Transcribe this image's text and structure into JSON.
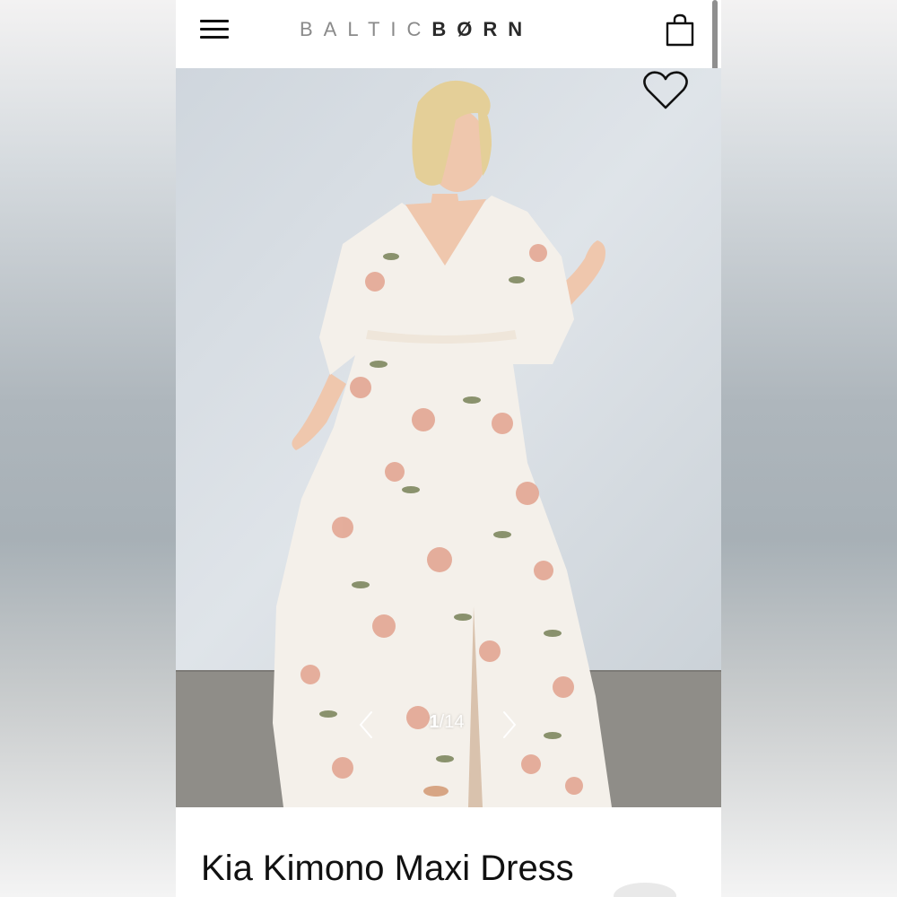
{
  "header": {
    "menu_icon": "hamburger-menu-icon",
    "logo_light": "BALTIC",
    "logo_dark": "BØRN",
    "cart_icon": "shopping-bag-icon"
  },
  "gallery": {
    "favorite_icon": "heart-icon",
    "prev_icon": "chevron-left-icon",
    "next_icon": "chevron-right-icon",
    "current": "1",
    "separator": "/",
    "total": "14"
  },
  "product": {
    "title": "Kia Kimono Maxi Dress"
  },
  "colors": {
    "page_bg": "#ffffff",
    "wall": "#d7dde3",
    "floor": "#8f8d88",
    "dress": "#f4f0ea",
    "floral_pink": "#e2a28e",
    "leaf_green": "#6f7a4e",
    "hair": "#e4cf98"
  }
}
